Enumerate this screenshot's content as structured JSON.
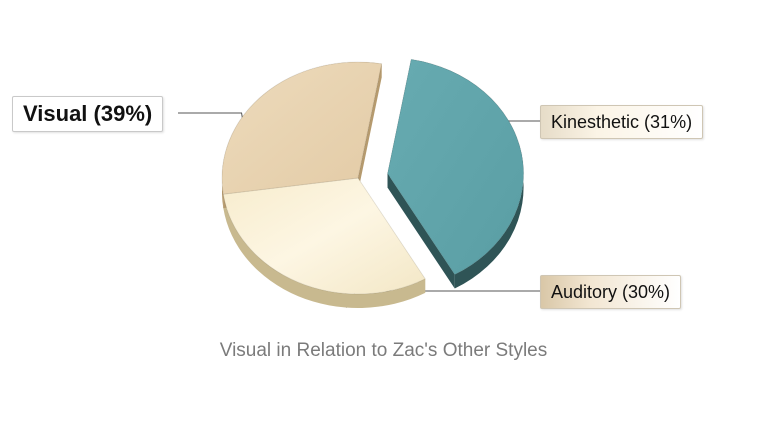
{
  "chart_data": {
    "type": "pie",
    "title": "Visual in Relation to Zac's Other Styles",
    "slices": [
      {
        "name": "Visual",
        "value": 39,
        "label": "Visual (39%)",
        "color": "#5fa4aa",
        "side_color": "#2f5456"
      },
      {
        "name": "Kinesthetic",
        "value": 31,
        "label": "Kinesthetic (31%)",
        "color": "#fcf4dc",
        "side_color": "#c8b98f"
      },
      {
        "name": "Auditory",
        "value": 30,
        "label": "Auditory (30%)",
        "color": "#e8d3b0",
        "side_color": "#b59a6e"
      }
    ],
    "exploded": "Visual",
    "legend": "none",
    "grid": false
  }
}
